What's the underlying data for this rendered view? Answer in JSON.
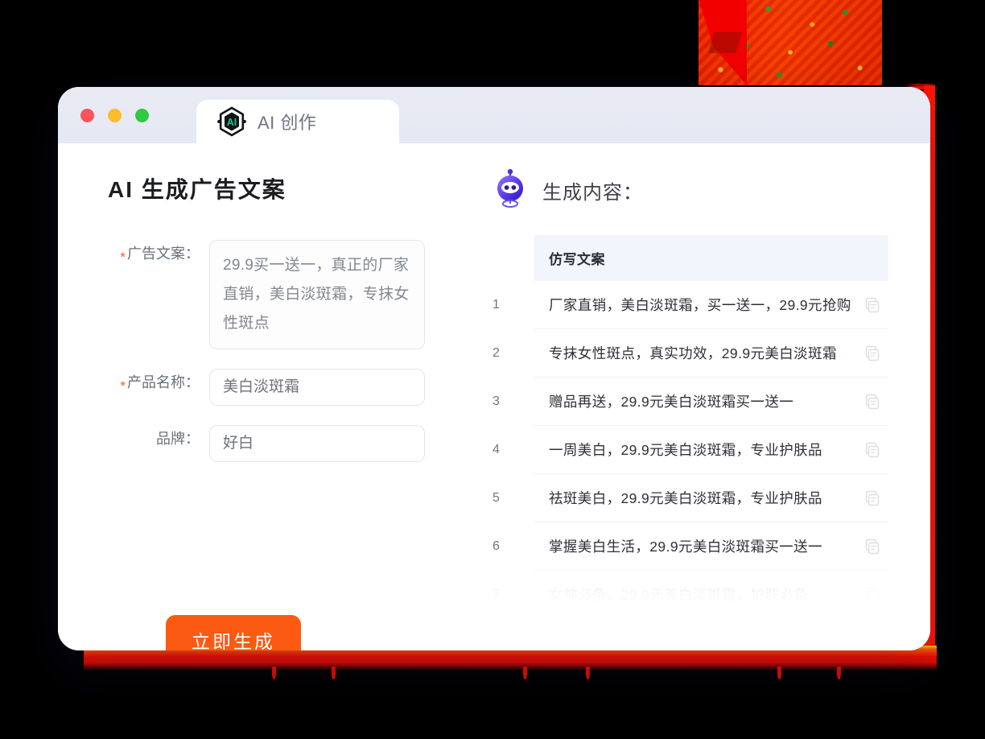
{
  "window": {
    "traffic_lights": [
      "close",
      "minimize",
      "maximize"
    ],
    "tab": {
      "label": "AI 创作",
      "logo_text": "AI"
    }
  },
  "left_panel": {
    "title": "AI 生成广告文案",
    "required_marker": "*",
    "fields": [
      {
        "label": "广告文案：",
        "required": true,
        "type": "textarea",
        "value": "29.9买一送一，真正的厂家直销，美白淡斑霜，专抹女性斑点"
      },
      {
        "label": "产品名称：",
        "required": true,
        "type": "input",
        "value": "美白淡斑霜"
      },
      {
        "label": "品牌：",
        "required": false,
        "type": "input",
        "value": "好白"
      }
    ],
    "submit_button": "立即生成"
  },
  "right_panel": {
    "title": "生成内容：",
    "robot_icon": "robot-icon",
    "table": {
      "columns": [
        "",
        "仿写文案",
        ""
      ],
      "rows": [
        {
          "n": "1",
          "text": "厂家直销，美白淡斑霜，买一送一，29.9元抢购",
          "faded": false
        },
        {
          "n": "2",
          "text": "专抹女性斑点，真实功效，29.9元美白淡斑霜",
          "faded": false
        },
        {
          "n": "3",
          "text": "赠品再送，29.9元美白淡斑霜买一送一",
          "faded": false
        },
        {
          "n": "4",
          "text": "一周美白，29.9元美白淡斑霜，专业护肤品",
          "faded": false
        },
        {
          "n": "5",
          "text": "祛斑美白，29.9元美白淡斑霜，专业护肤品",
          "faded": false
        },
        {
          "n": "6",
          "text": "掌握美白生活，29.9元美白淡斑霜买一送一",
          "faded": false
        },
        {
          "n": "7",
          "text": "女神必备，29.9元美白淡斑霜，护肤必备",
          "faded": true
        }
      ]
    }
  },
  "colors": {
    "accent_orange": "#fb5a12",
    "required_red": "#ff5a2b",
    "titlebar": "#e7e9f3",
    "table_header_bg": "#f2f5fb",
    "logo_green": "#19c37d",
    "robot_purple": "#4b2ee0",
    "decoration_red": "#ef0d00"
  }
}
